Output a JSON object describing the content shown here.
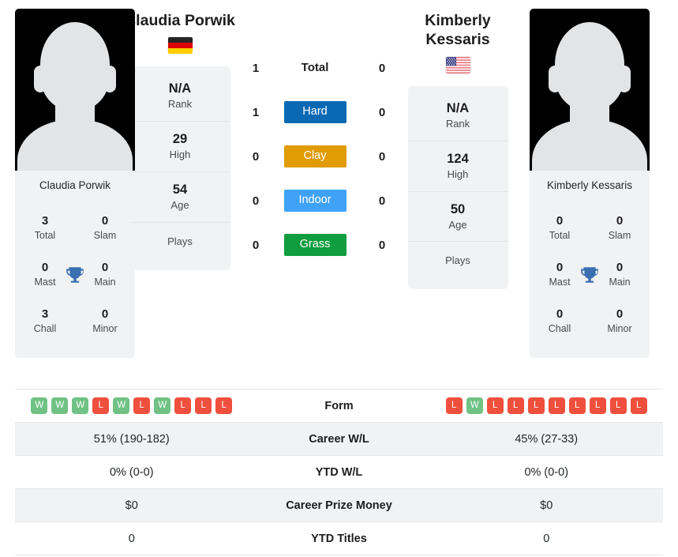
{
  "players": {
    "left": {
      "name": "Claudia Porwik",
      "photo_caption": "Claudia Porwik",
      "country_flag": "germany-flag",
      "rank": {
        "value": "N/A",
        "label": "Rank"
      },
      "high": {
        "value": "29",
        "label": "High"
      },
      "age": {
        "value": "54",
        "label": "Age"
      },
      "plays": {
        "label": "Plays"
      },
      "titles": {
        "total": {
          "value": "3",
          "label": "Total"
        },
        "slam": {
          "value": "0",
          "label": "Slam"
        },
        "mast": {
          "value": "0",
          "label": "Mast"
        },
        "main": {
          "value": "0",
          "label": "Main"
        },
        "chall": {
          "value": "3",
          "label": "Chall"
        },
        "minor": {
          "value": "0",
          "label": "Minor"
        }
      },
      "form": [
        "W",
        "W",
        "W",
        "L",
        "W",
        "L",
        "W",
        "L",
        "L",
        "L"
      ],
      "career_wl": "51% (190-182)",
      "ytd_wl": "0% (0-0)",
      "career_prize_money": "$0",
      "ytd_titles": "0"
    },
    "right": {
      "name": "Kimberly Kessaris",
      "photo_caption": "Kimberly Kessaris",
      "country_flag": "usa-flag",
      "rank": {
        "value": "N/A",
        "label": "Rank"
      },
      "high": {
        "value": "124",
        "label": "High"
      },
      "age": {
        "value": "50",
        "label": "Age"
      },
      "plays": {
        "label": "Plays"
      },
      "titles": {
        "total": {
          "value": "0",
          "label": "Total"
        },
        "slam": {
          "value": "0",
          "label": "Slam"
        },
        "mast": {
          "value": "0",
          "label": "Mast"
        },
        "main": {
          "value": "0",
          "label": "Main"
        },
        "chall": {
          "value": "0",
          "label": "Chall"
        },
        "minor": {
          "value": "0",
          "label": "Minor"
        }
      },
      "form": [
        "L",
        "W",
        "L",
        "L",
        "L",
        "L",
        "L",
        "L",
        "L",
        "L"
      ],
      "career_wl": "45% (27-33)",
      "ytd_wl": "0% (0-0)",
      "career_prize_money": "$0",
      "ytd_titles": "0"
    }
  },
  "head_to_head": {
    "rows": [
      {
        "label": "Total",
        "left": "1",
        "right": "0",
        "badge": false,
        "color": ""
      },
      {
        "label": "Hard",
        "left": "1",
        "right": "0",
        "badge": true,
        "color": "#0b69b4"
      },
      {
        "label": "Clay",
        "left": "0",
        "right": "0",
        "badge": true,
        "color": "#e09b05"
      },
      {
        "label": "Indoor",
        "left": "0",
        "right": "0",
        "badge": true,
        "color": "#3fa2f7"
      },
      {
        "label": "Grass",
        "left": "0",
        "right": "0",
        "badge": true,
        "color": "#0f9d3f"
      }
    ]
  },
  "comparison_table": {
    "rows": [
      {
        "label": "Form",
        "left": "",
        "right": ""
      },
      {
        "label": "Career W/L",
        "left": "51% (190-182)",
        "right": "45% (27-33)"
      },
      {
        "label": "YTD W/L",
        "left": "0% (0-0)",
        "right": "0% (0-0)"
      },
      {
        "label": "Career Prize Money",
        "left": "$0",
        "right": "$0"
      },
      {
        "label": "YTD Titles",
        "left": "0",
        "right": "0"
      }
    ]
  },
  "colors": {
    "hard": "#0b69b4",
    "clay": "#e09b05",
    "indoor": "#3fa2f7",
    "grass": "#0f9d3f",
    "win": "#6fc284",
    "loss": "#ef4f3d",
    "card_bg": "#f1f2f3"
  }
}
